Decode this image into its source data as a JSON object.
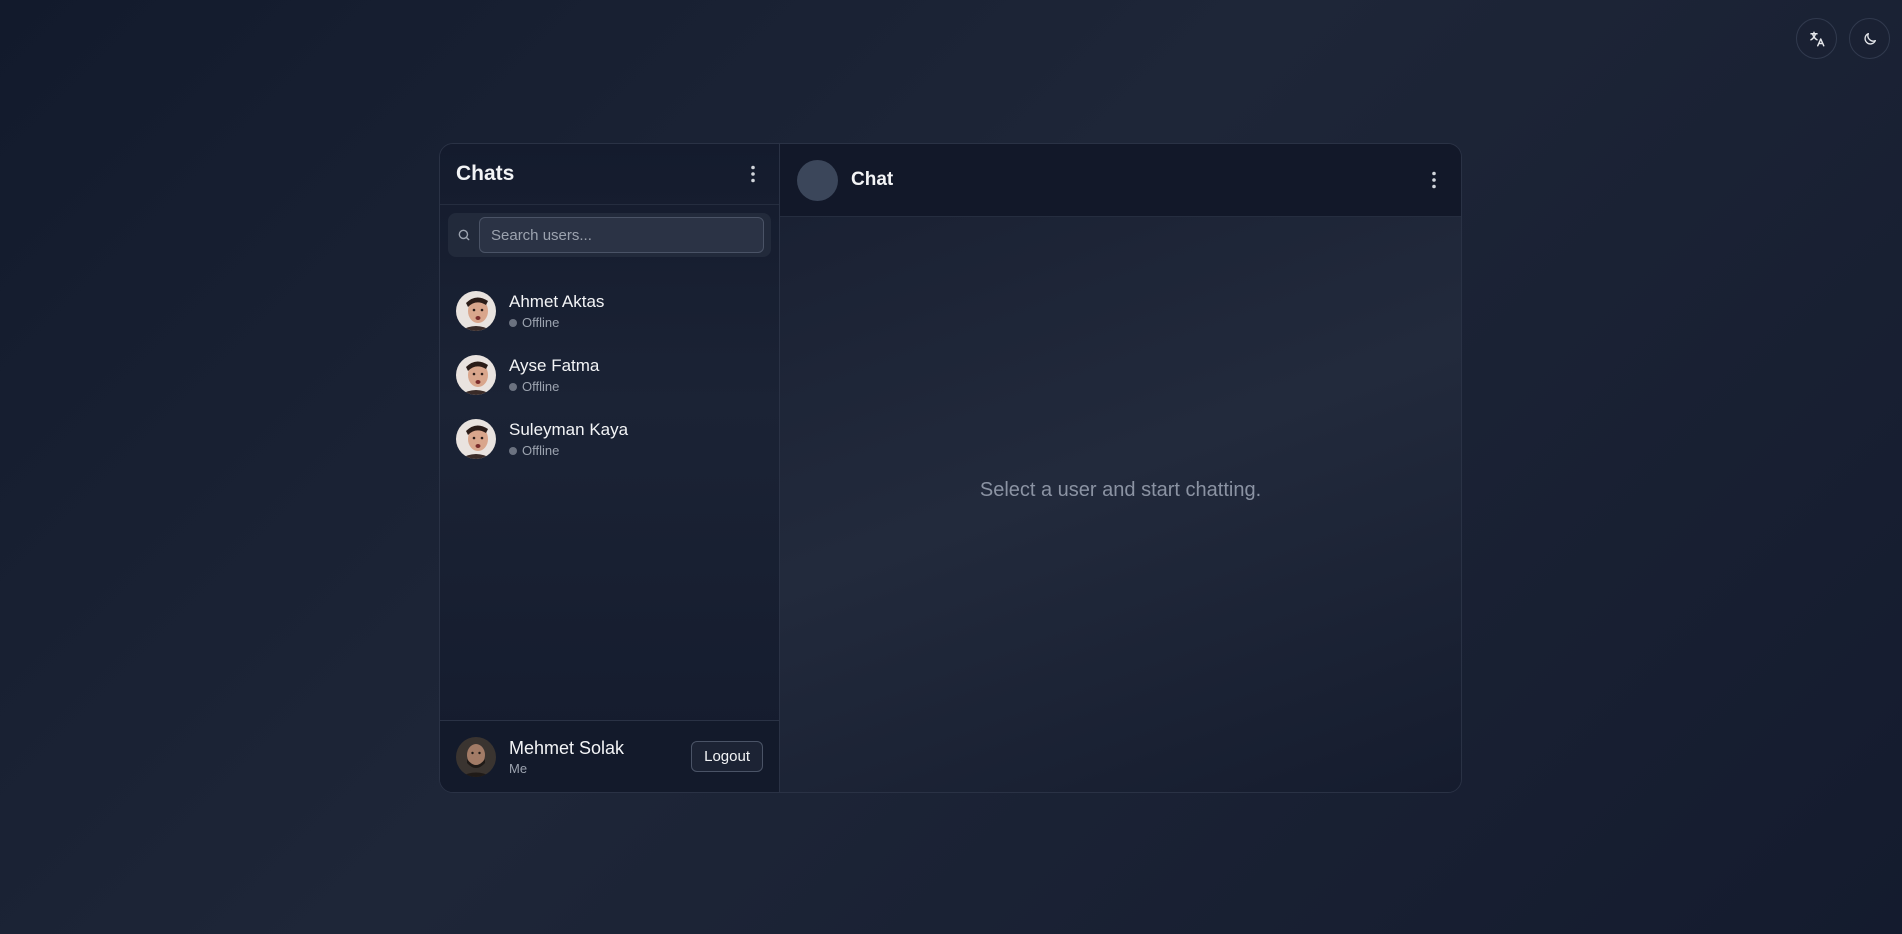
{
  "top_actions": {
    "translate_icon": "translate-icon",
    "theme_icon": "moon-icon"
  },
  "sidebar": {
    "title": "Chats",
    "search": {
      "placeholder": "Search users...",
      "value": ""
    },
    "users": [
      {
        "name": "Ahmet Aktas",
        "status": "Offline"
      },
      {
        "name": "Ayse Fatma",
        "status": "Offline"
      },
      {
        "name": "Suleyman Kaya",
        "status": "Offline"
      }
    ],
    "footer": {
      "name": "Mehmet Solak",
      "subtitle": "Me",
      "logout_label": "Logout"
    }
  },
  "chat": {
    "title": "Chat",
    "empty_message": "Select a user and start chatting."
  },
  "colors": {
    "status_offline": "#6b7280",
    "background": "#1a2133"
  }
}
